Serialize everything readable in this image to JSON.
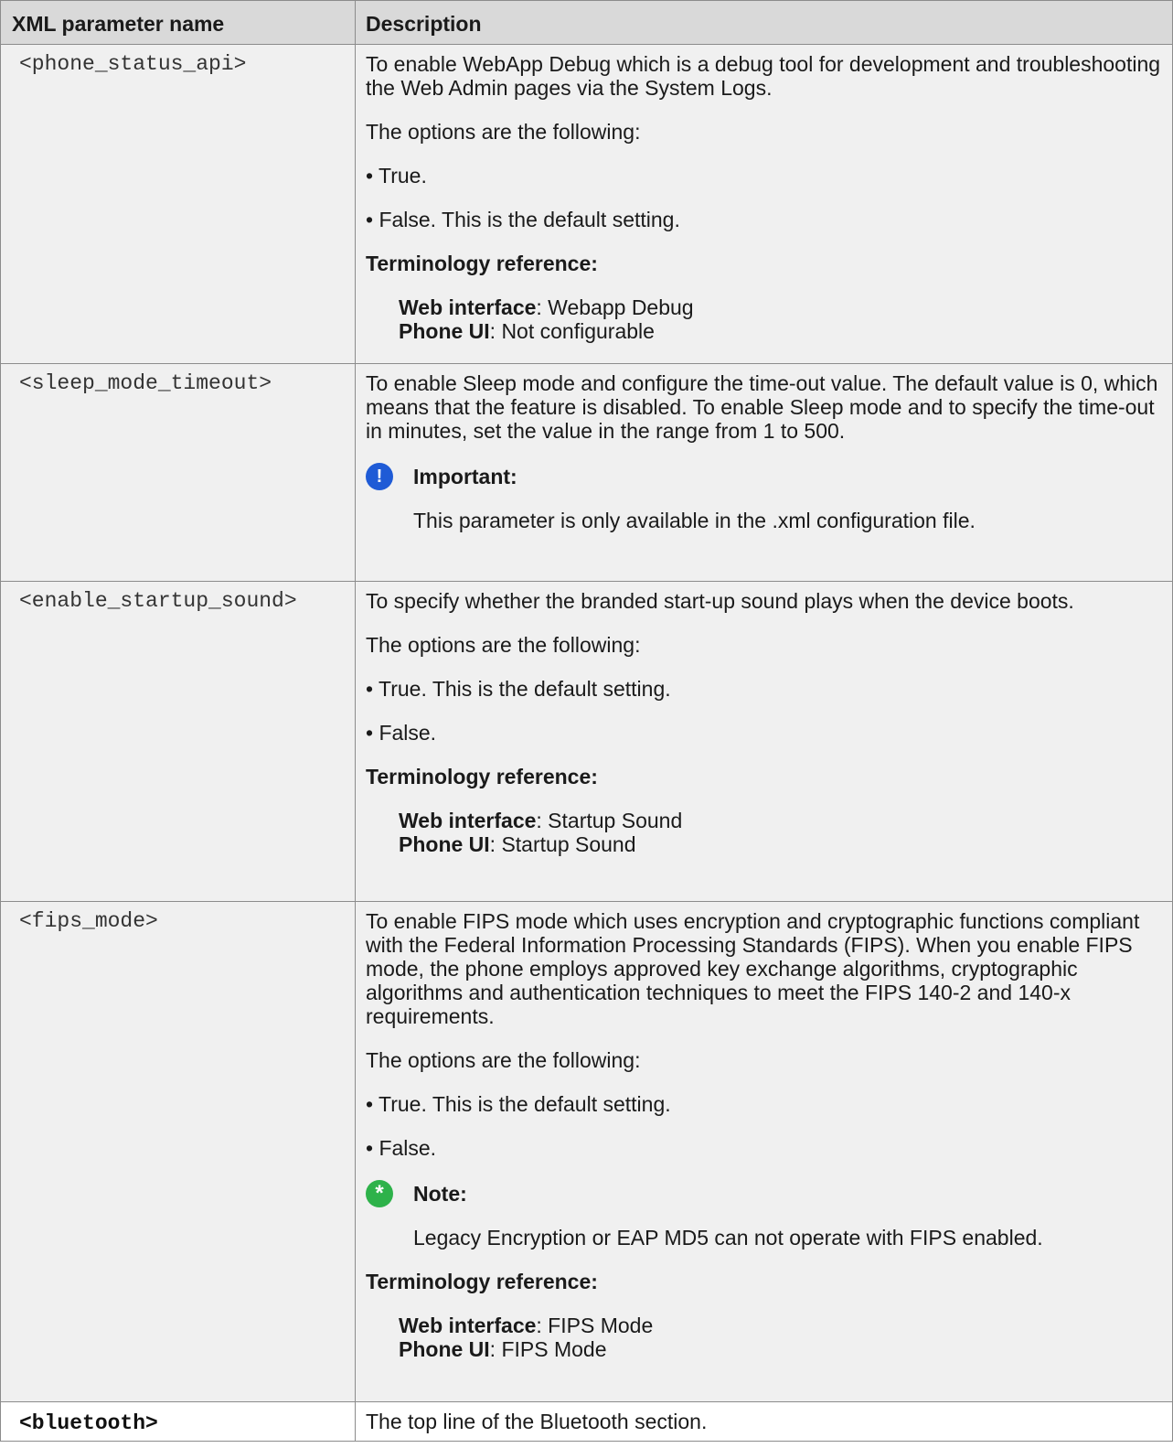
{
  "table": {
    "headers": [
      "XML parameter name",
      "Description"
    ],
    "rows": [
      {
        "name": "<phone_status_api>",
        "desc1": "To enable WebApp Debug which is a debug tool for development and troubleshooting the Web Admin pages via the System Logs.",
        "options_intro": "The options are the following:",
        "opt1": "• True.",
        "opt2": "• False. This is the default setting.",
        "term_head": "Terminology reference:",
        "web_label": "Web interface",
        "web_value": ": Webapp Debug",
        "phone_label": "Phone UI",
        "phone_value": ": Not configurable"
      },
      {
        "name": "<sleep_mode_timeout>",
        "desc1": "To enable Sleep mode and configure the time-out value. The default value is 0, which means that the feature is disabled. To enable Sleep mode and to specify the time-out in minutes, set the value in the range from 1 to 500.",
        "callout_icon": "!",
        "callout_title": "Important:",
        "callout_text": "This parameter is only available in the .xml configuration file."
      },
      {
        "name": "<enable_startup_sound>",
        "desc1": "To specify whether the branded start-up sound plays when the device boots.",
        "options_intro": "The options are the following:",
        "opt1": "• True. This is the default setting.",
        "opt2": "• False.",
        "term_head": "Terminology reference:",
        "web_label": "Web interface",
        "web_value": ": Startup Sound",
        "phone_label": "Phone UI",
        "phone_value": ": Startup Sound"
      },
      {
        "name": "<fips_mode>",
        "desc1": "To enable FIPS mode which uses encryption and cryptographic functions compliant with the Federal Information Processing Standards (FIPS). When you enable FIPS mode, the phone employs approved key exchange algorithms, cryptographic algorithms and authentication techniques to meet the FIPS 140-2 and 140-x requirements.",
        "options_intro": "The options are the following:",
        "opt1": "• True. This is the default setting.",
        "opt2": "• False.",
        "callout_icon": "*",
        "callout_title": "Note:",
        "callout_text": "Legacy Encryption or EAP MD5 can not operate with FIPS enabled.",
        "term_head": "Terminology reference:",
        "web_label": "Web interface",
        "web_value": ": FIPS Mode",
        "phone_label": "Phone UI",
        "phone_value": ": FIPS Mode"
      },
      {
        "name": "<bluetooth>",
        "desc1": "The top line of the Bluetooth section."
      }
    ]
  },
  "colors": {
    "header_bg": "#d9d9d9",
    "row_bg": "#f0f0f0",
    "important_icon": "#1f5bd6",
    "note_icon": "#2eb24a"
  },
  "icons": {
    "important": "exclamation-circle-icon",
    "note": "asterisk-circle-icon"
  }
}
